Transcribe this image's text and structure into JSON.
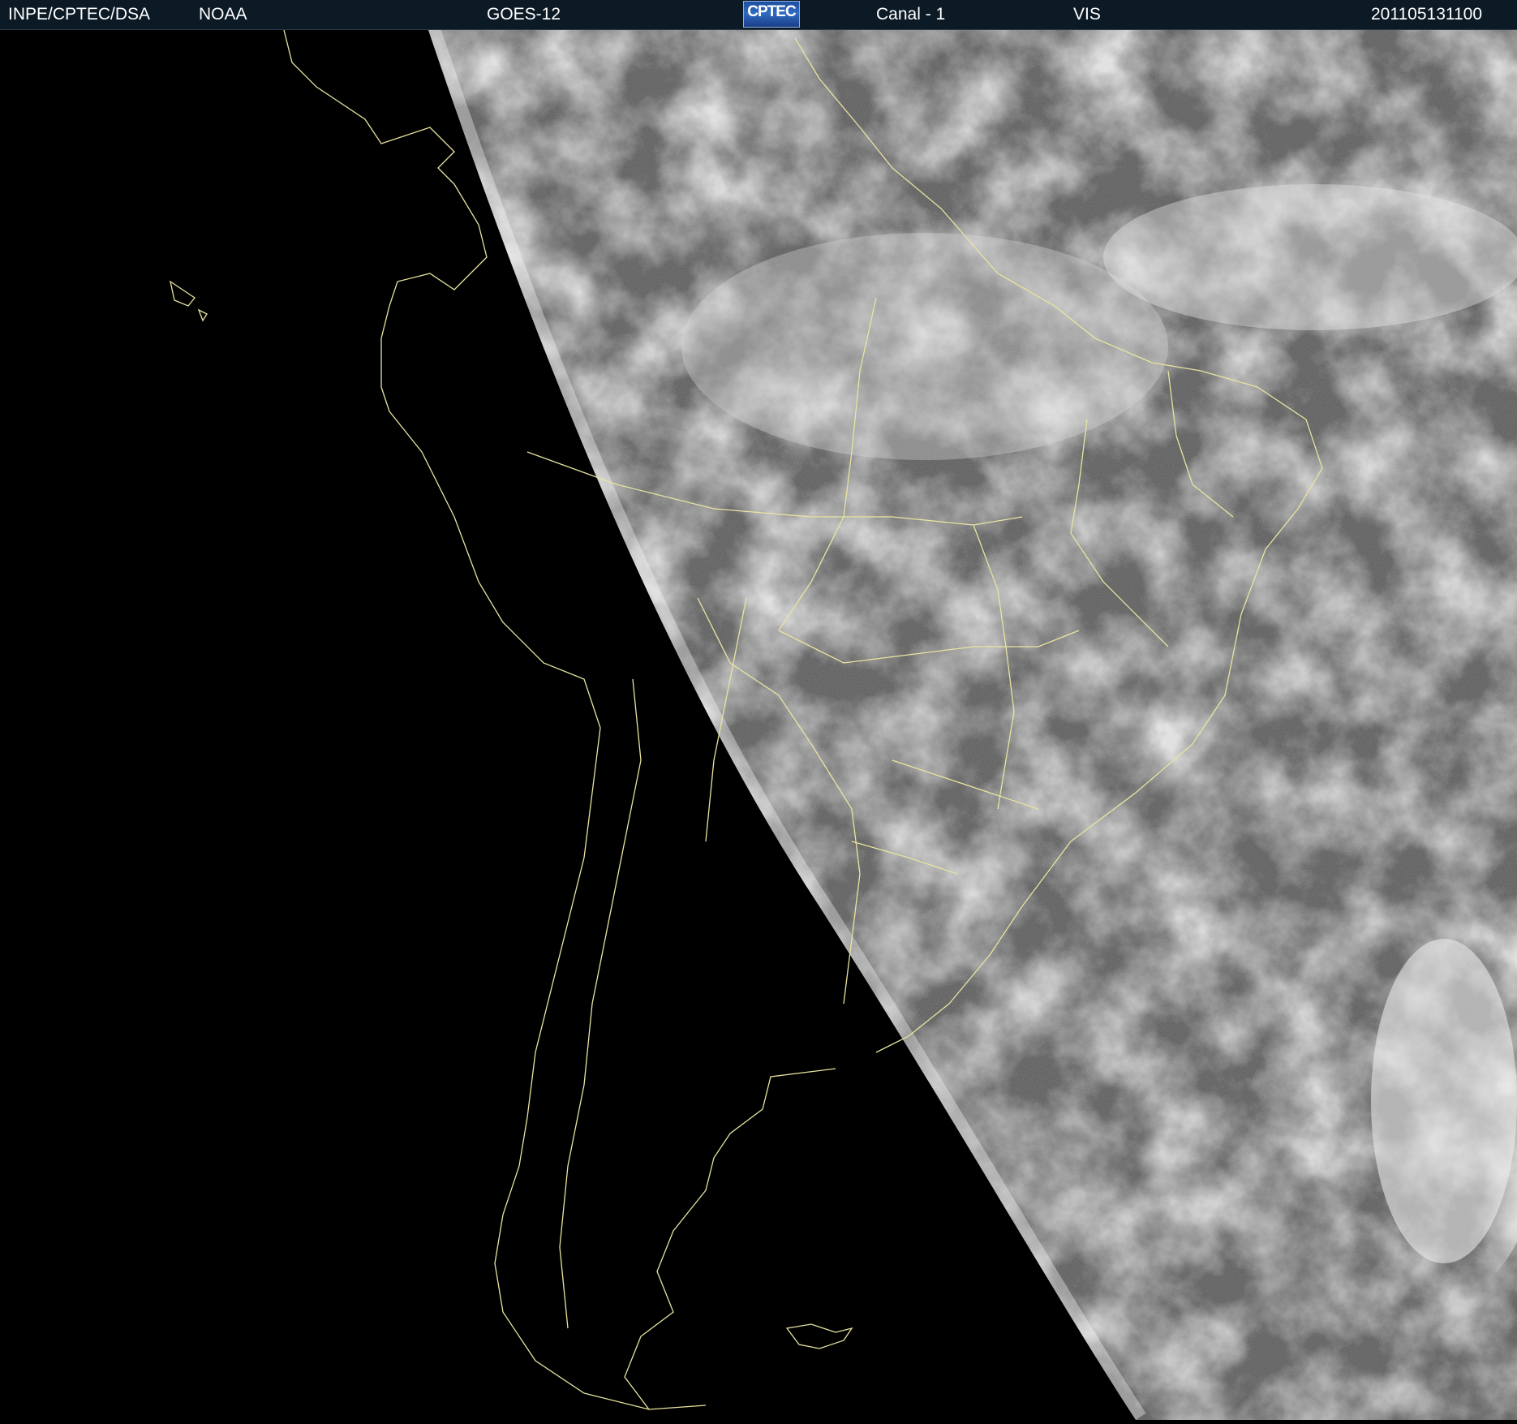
{
  "header": {
    "agency": "INPE/CPTEC/DSA",
    "provider": "NOAA",
    "satellite": "GOES-12",
    "logo_text": "CPTEC",
    "channel": "Canal - 1",
    "band": "VIS",
    "timestamp": "201105131100"
  },
  "colors": {
    "space": "#000000",
    "header_bg": "#0c1a26",
    "coastline": "#e8e4a0",
    "cloud": "#d8d8d8",
    "ocean_land": "#5a5a5a"
  }
}
